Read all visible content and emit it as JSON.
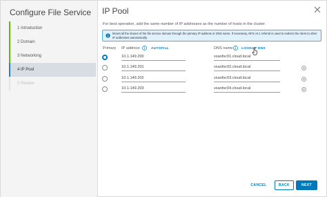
{
  "sidebar": {
    "title": "Configure File Service",
    "steps": [
      {
        "label": "1  Introduction"
      },
      {
        "label": "2  Domain"
      },
      {
        "label": "3  Networking"
      },
      {
        "label": "4  IP Pool"
      },
      {
        "label": "5  Review"
      }
    ]
  },
  "main": {
    "title": "IP Pool",
    "description": "For best operation, add the same number of IP addresses as the number of hosts in the cluster.",
    "info": "Mount all the shares of the file service domain through the primary IP address or DNS name. If necessary, NFS v4.1 referral is used to redirect the client to other IP addresses automatically.",
    "headers": {
      "primary": "Primary",
      "ip_address": "IP address",
      "autofill": "AUTOFILL",
      "dns_name": "DNS name",
      "lookup_dns": "LOOKUP DNS"
    },
    "rows": [
      {
        "ip": "10.1.149.200",
        "dns": "vsanfsc01.cloud.local",
        "primary": true
      },
      {
        "ip": "10.1.149.201",
        "dns": "vsanfsc02.cloud.local",
        "primary": false
      },
      {
        "ip": "10.1.149.202",
        "dns": "vsanfsc03.cloud.local",
        "primary": false
      },
      {
        "ip": "10.1.149.203",
        "dns": "vsanfsc04.cloud.local",
        "primary": false
      }
    ]
  },
  "footer": {
    "cancel": "CANCEL",
    "back": "BACK",
    "next": "NEXT"
  },
  "colors": {
    "accent": "#0079b8",
    "completed_step": "#5eb715",
    "info_bg": "#e1f1fb"
  },
  "icons": [
    "close-icon",
    "info-icon",
    "remove-icon",
    "cursor-icon"
  ]
}
